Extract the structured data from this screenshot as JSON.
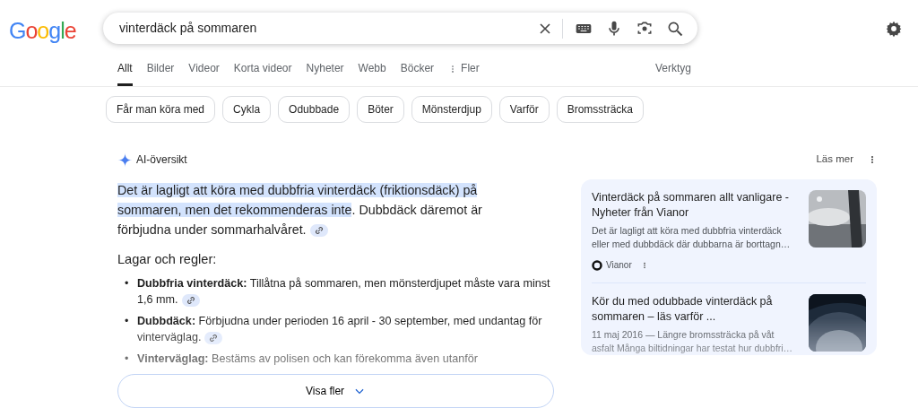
{
  "logo": "Google",
  "search": {
    "value": "vinterdäck på sommaren"
  },
  "tabs": [
    {
      "label": "Allt",
      "selected": true
    },
    {
      "label": "Bilder",
      "selected": false
    },
    {
      "label": "Videor",
      "selected": false
    },
    {
      "label": "Korta videor",
      "selected": false
    },
    {
      "label": "Nyheter",
      "selected": false
    },
    {
      "label": "Webb",
      "selected": false
    },
    {
      "label": "Böcker",
      "selected": false
    },
    {
      "label": "Fler",
      "selected": false,
      "kind": "more"
    }
  ],
  "tools": "Verktyg",
  "chips": [
    "Får man köra med",
    "Cykla",
    "Odubbade",
    "Böter",
    "Mönsterdjup",
    "Varför",
    "Bromssträcka"
  ],
  "ai_overview": {
    "title": "AI-översikt",
    "read_more": "Läs mer",
    "summary_highlight": "Det är lagligt att köra med dubbfria vinterdäck (friktionsdäck) på sommaren, men det rekommenderas inte",
    "summary_rest": ". Dubbdäck däremot är förbjudna under sommarhalvåret.",
    "heading": "Lagar och regler:",
    "items": [
      {
        "marker": "•",
        "term": "Dubbfria vinterdäck:",
        "text": "Tillåtna på sommaren, men mönsterdjupet måste vara minst 1,6 mm.",
        "link": true
      },
      {
        "marker": "•",
        "term": "Dubbdäck:",
        "text": "Förbjudna under perioden 16 april - 30 september, med undantag för vinterväglag.",
        "link": true
      },
      {
        "marker": "•",
        "term": "Vinterväglag:",
        "text": "Bestäms av polisen och kan förekomma även utanför",
        "link": false
      }
    ],
    "show_more": "Visa fler",
    "sources": [
      {
        "title": "Vinterdäck på sommaren allt vanligare - Nyheter från Vianor",
        "snippet": "Det är lagligt att köra med dubbfria vinterdäck eller med dubbdäck där dubbarna är borttagn…",
        "site": "Vianor"
      },
      {
        "title": "Kör du med odubbade vinterdäck på sommaren – läs varför ...",
        "snippet": "11 maj 2016 — Längre bromssträcka på våt asfalt Många biltidningar har testat hur dubbfri…"
      }
    ]
  }
}
